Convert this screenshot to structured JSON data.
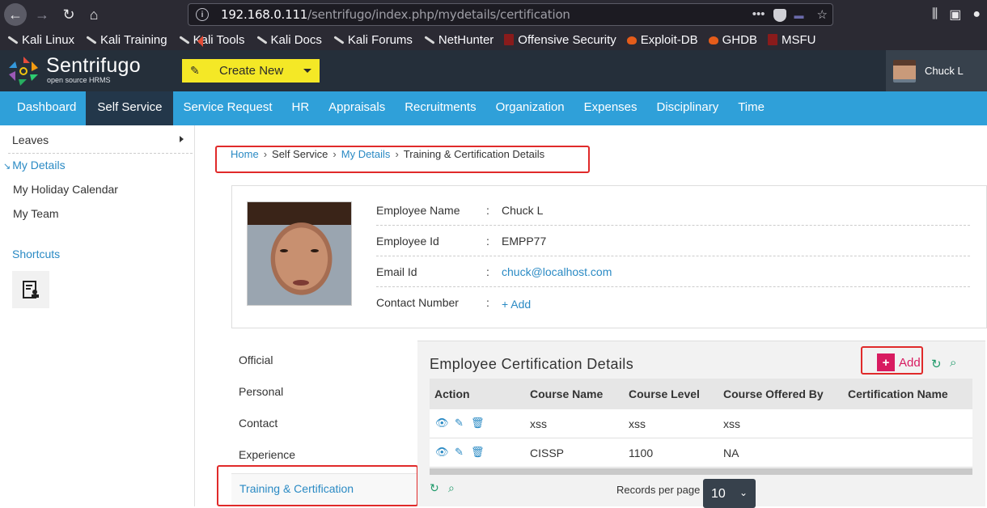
{
  "browser": {
    "url_host": "192.168.0.111",
    "url_path": "/sentrifugo/index.php/mydetails/certification",
    "more": "•••",
    "bookmarks": [
      {
        "label": "Kali Linux",
        "icon": "kali-dragon-icon"
      },
      {
        "label": "Kali Training",
        "icon": "kali-dragon-icon"
      },
      {
        "label": "Kali Tools",
        "icon": "kali-dragon-icon"
      },
      {
        "label": "Kali Docs",
        "icon": "kali-dragon-icon"
      },
      {
        "label": "Kali Forums",
        "icon": "kali-dragon-icon"
      },
      {
        "label": "NetHunter",
        "icon": "kali-dragon-icon"
      },
      {
        "label": "Offensive Security",
        "icon": "offsec-icon"
      },
      {
        "label": "Exploit-DB",
        "icon": "exploitdb-icon"
      },
      {
        "label": "GHDB",
        "icon": "exploitdb-icon"
      },
      {
        "label": "MSFU",
        "icon": "offsec-icon"
      }
    ]
  },
  "header": {
    "brand": "Sentrifugo",
    "brand_sub": "open source HRMS",
    "create_new": "Create New",
    "user_name": "Chuck L"
  },
  "nav": {
    "items": [
      "Dashboard",
      "Self Service",
      "Service Request",
      "HR",
      "Appraisals",
      "Recruitments",
      "Organization",
      "Expenses",
      "Disciplinary",
      "Time"
    ],
    "active": "Self Service"
  },
  "sidebar": {
    "leaves": "Leaves",
    "my_details": "My Details",
    "holiday_calendar": "My Holiday Calendar",
    "my_team": "My Team",
    "shortcuts": "Shortcuts"
  },
  "breadcrumb": {
    "home": "Home",
    "self_service": "Self Service",
    "my_details": "My Details",
    "current": "Training & Certification Details"
  },
  "profile": {
    "rows": [
      {
        "label": "Employee Name",
        "value": "Chuck L"
      },
      {
        "label": "Employee Id",
        "value": "EMPP77"
      },
      {
        "label": "Email Id",
        "value": "chuck@localhost.com"
      },
      {
        "label": "Contact Number",
        "value": "+ Add"
      }
    ],
    "colon": ":"
  },
  "tabs": {
    "official": "Official",
    "personal": "Personal",
    "contact": "Contact",
    "experience": "Experience",
    "training": "Training & Certification"
  },
  "certification": {
    "title": "Employee Certification Details",
    "add_label": "Add",
    "columns": [
      "Action",
      "Course Name",
      "Course Level",
      "Course Offered By",
      "Certification Name"
    ],
    "rows": [
      {
        "course_name": "xss",
        "course_level": "xss",
        "offered_by": "xss",
        "cert_name": ""
      },
      {
        "course_name": "CISSP",
        "course_level": "1100",
        "offered_by": "NA",
        "cert_name": ""
      }
    ],
    "records_per_page_label": "Records per page",
    "records_per_page": "10"
  },
  "colors": {
    "nav_blue": "#2fa0d9",
    "header_dark": "#252f3a",
    "create_yellow": "#f4e826",
    "highlight_red": "#e02a2a",
    "add_pink": "#d81b60",
    "link_blue": "#2a8ac4"
  }
}
